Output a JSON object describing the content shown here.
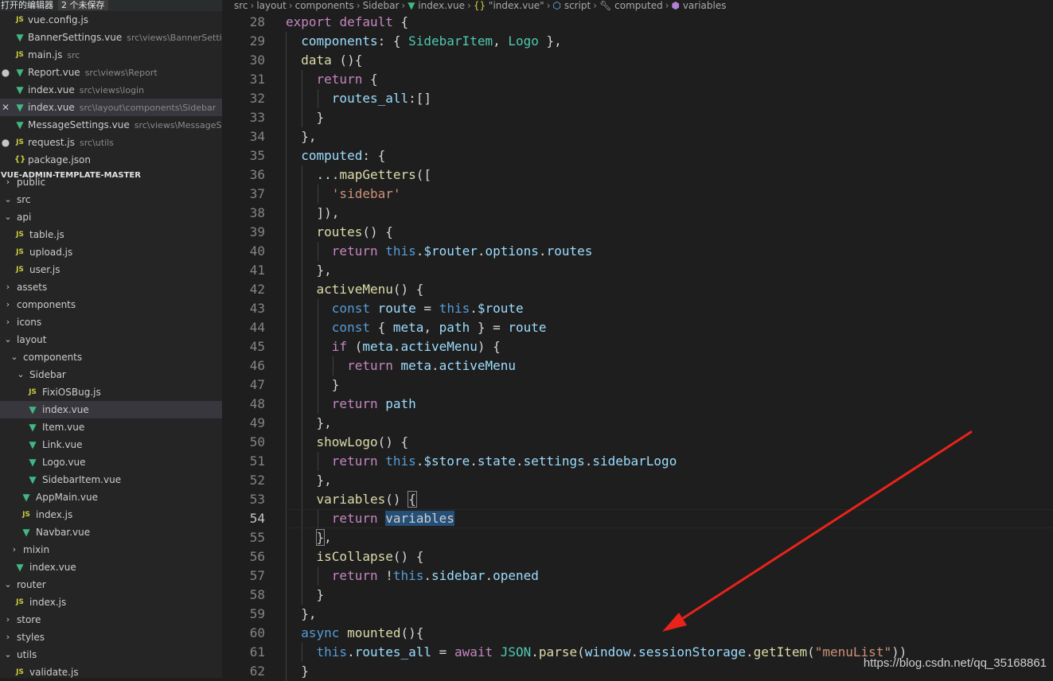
{
  "open_editors": {
    "title": "打开的编辑器",
    "unsaved": "2 个未保存",
    "files": [
      {
        "icon": "JS",
        "name": "vue.config.js",
        "path": "",
        "marker": ""
      },
      {
        "icon": "V",
        "name": "BannerSettings.vue",
        "path": "src\\views\\BannerSettin...",
        "marker": ""
      },
      {
        "icon": "JS",
        "name": "main.js",
        "path": "src",
        "marker": ""
      },
      {
        "icon": "V",
        "name": "Report.vue",
        "path": "src\\views\\Report",
        "marker": "●"
      },
      {
        "icon": "V",
        "name": "index.vue",
        "path": "src\\views\\login",
        "marker": ""
      },
      {
        "icon": "V",
        "name": "index.vue",
        "path": "src\\layout\\components\\Sidebar",
        "marker": "✕"
      },
      {
        "icon": "V",
        "name": "MessageSettings.vue",
        "path": "src\\views\\MessageS...",
        "marker": ""
      },
      {
        "icon": "JS",
        "name": "request.js",
        "path": "src\\utils",
        "marker": "●"
      },
      {
        "icon": "{}",
        "name": "package.json",
        "path": "",
        "marker": ""
      }
    ]
  },
  "explorer": {
    "title": "VUE-ADMIN-TEMPLATE-MASTER",
    "tree": [
      {
        "label": "public",
        "type": "folder",
        "chev": "›"
      },
      {
        "label": "src",
        "type": "folder",
        "chev": "⌄"
      },
      {
        "label": "api",
        "type": "folder",
        "chev": "⌄"
      },
      {
        "label": "table.js",
        "type": "js",
        "chev": ""
      },
      {
        "label": "upload.js",
        "type": "js",
        "chev": ""
      },
      {
        "label": "user.js",
        "type": "js",
        "chev": ""
      },
      {
        "label": "assets",
        "type": "folder",
        "chev": "›"
      },
      {
        "label": "components",
        "type": "folder",
        "chev": "›"
      },
      {
        "label": "icons",
        "type": "folder",
        "chev": "›"
      },
      {
        "label": "layout",
        "type": "folder",
        "chev": "⌄"
      },
      {
        "label": "components",
        "type": "folder",
        "chev": "⌄"
      },
      {
        "label": "Sidebar",
        "type": "folder",
        "chev": "⌄"
      },
      {
        "label": "FixiOSBug.js",
        "type": "js",
        "chev": ""
      },
      {
        "label": "index.vue",
        "type": "vue",
        "chev": ""
      },
      {
        "label": "Item.vue",
        "type": "vue",
        "chev": ""
      },
      {
        "label": "Link.vue",
        "type": "vue",
        "chev": ""
      },
      {
        "label": "Logo.vue",
        "type": "vue",
        "chev": ""
      },
      {
        "label": "SidebarItem.vue",
        "type": "vue",
        "chev": ""
      },
      {
        "label": "AppMain.vue",
        "type": "vue",
        "chev": ""
      },
      {
        "label": "index.js",
        "type": "js",
        "chev": ""
      },
      {
        "label": "Navbar.vue",
        "type": "vue",
        "chev": ""
      },
      {
        "label": "mixin",
        "type": "folder",
        "chev": "›"
      },
      {
        "label": "index.vue",
        "type": "vue",
        "chev": ""
      },
      {
        "label": "router",
        "type": "folder",
        "chev": "⌄"
      },
      {
        "label": "index.js",
        "type": "js",
        "chev": ""
      },
      {
        "label": "store",
        "type": "folder",
        "chev": "›"
      },
      {
        "label": "styles",
        "type": "folder",
        "chev": "›"
      },
      {
        "label": "utils",
        "type": "folder",
        "chev": "⌄"
      },
      {
        "label": "validate.js",
        "type": "js",
        "chev": ""
      }
    ]
  },
  "breadcrumb": [
    "src",
    "layout",
    "components",
    "Sidebar",
    "index.vue",
    "\"index.vue\"",
    "script",
    "computed",
    "variables"
  ],
  "code_lines": [
    {
      "n": "28",
      "tokens": [
        [
          "kc",
          "export"
        ],
        [
          "pl",
          " "
        ],
        [
          "kc",
          "default"
        ],
        [
          "pl",
          " {"
        ]
      ]
    },
    {
      "n": "29",
      "tokens": [
        [
          "pl",
          "  "
        ],
        [
          "pr",
          "components"
        ],
        [
          "pl",
          ": { "
        ],
        [
          "cls",
          "SidebarItem"
        ],
        [
          "pl",
          ", "
        ],
        [
          "cls",
          "Logo"
        ],
        [
          "pl",
          " },"
        ]
      ]
    },
    {
      "n": "30",
      "tokens": [
        [
          "pl",
          "  "
        ],
        [
          "fn",
          "data"
        ],
        [
          "pl",
          " (){"
        ]
      ]
    },
    {
      "n": "31",
      "tokens": [
        [
          "pl",
          "    "
        ],
        [
          "kc",
          "return"
        ],
        [
          "pl",
          " {"
        ]
      ]
    },
    {
      "n": "32",
      "tokens": [
        [
          "pl",
          "      "
        ],
        [
          "pr",
          "routes_all"
        ],
        [
          "pl",
          ":[]"
        ]
      ]
    },
    {
      "n": "33",
      "tokens": [
        [
          "pl",
          "    }"
        ]
      ]
    },
    {
      "n": "34",
      "tokens": [
        [
          "pl",
          "  },"
        ]
      ]
    },
    {
      "n": "35",
      "tokens": [
        [
          "pl",
          "  "
        ],
        [
          "pr",
          "computed"
        ],
        [
          "pl",
          ": {"
        ]
      ]
    },
    {
      "n": "36",
      "tokens": [
        [
          "pl",
          "    ..."
        ],
        [
          "fn",
          "mapGetters"
        ],
        [
          "pl",
          "(["
        ]
      ]
    },
    {
      "n": "37",
      "tokens": [
        [
          "pl",
          "      "
        ],
        [
          "st",
          "'sidebar'"
        ]
      ]
    },
    {
      "n": "38",
      "tokens": [
        [
          "pl",
          "    ]),"
        ]
      ]
    },
    {
      "n": "39",
      "tokens": [
        [
          "pl",
          "    "
        ],
        [
          "fn",
          "routes"
        ],
        [
          "pl",
          "() {"
        ]
      ]
    },
    {
      "n": "40",
      "tokens": [
        [
          "pl",
          "      "
        ],
        [
          "kc",
          "return"
        ],
        [
          "pl",
          " "
        ],
        [
          "kw",
          "this"
        ],
        [
          "pl",
          "."
        ],
        [
          "pr",
          "$router"
        ],
        [
          "pl",
          "."
        ],
        [
          "pr",
          "options"
        ],
        [
          "pl",
          "."
        ],
        [
          "pr",
          "routes"
        ]
      ]
    },
    {
      "n": "41",
      "tokens": [
        [
          "pl",
          "    },"
        ]
      ]
    },
    {
      "n": "42",
      "tokens": [
        [
          "pl",
          "    "
        ],
        [
          "fn",
          "activeMenu"
        ],
        [
          "pl",
          "() {"
        ]
      ]
    },
    {
      "n": "43",
      "tokens": [
        [
          "pl",
          "      "
        ],
        [
          "kw",
          "const"
        ],
        [
          "pl",
          " "
        ],
        [
          "pr",
          "route"
        ],
        [
          "pl",
          " = "
        ],
        [
          "kw",
          "this"
        ],
        [
          "pl",
          "."
        ],
        [
          "pr",
          "$route"
        ]
      ]
    },
    {
      "n": "44",
      "tokens": [
        [
          "pl",
          "      "
        ],
        [
          "kw",
          "const"
        ],
        [
          "pl",
          " { "
        ],
        [
          "pr",
          "meta"
        ],
        [
          "pl",
          ", "
        ],
        [
          "pr",
          "path"
        ],
        [
          "pl",
          " } = "
        ],
        [
          "pr",
          "route"
        ]
      ]
    },
    {
      "n": "45",
      "tokens": [
        [
          "pl",
          "      "
        ],
        [
          "kc",
          "if"
        ],
        [
          "pl",
          " ("
        ],
        [
          "pr",
          "meta"
        ],
        [
          "pl",
          "."
        ],
        [
          "pr",
          "activeMenu"
        ],
        [
          "pl",
          ") {"
        ]
      ]
    },
    {
      "n": "46",
      "tokens": [
        [
          "pl",
          "        "
        ],
        [
          "kc",
          "return"
        ],
        [
          "pl",
          " "
        ],
        [
          "pr",
          "meta"
        ],
        [
          "pl",
          "."
        ],
        [
          "pr",
          "activeMenu"
        ]
      ]
    },
    {
      "n": "47",
      "tokens": [
        [
          "pl",
          "      }"
        ]
      ]
    },
    {
      "n": "48",
      "tokens": [
        [
          "pl",
          "      "
        ],
        [
          "kc",
          "return"
        ],
        [
          "pl",
          " "
        ],
        [
          "pr",
          "path"
        ]
      ]
    },
    {
      "n": "49",
      "tokens": [
        [
          "pl",
          "    },"
        ]
      ]
    },
    {
      "n": "50",
      "tokens": [
        [
          "pl",
          "    "
        ],
        [
          "fn",
          "showLogo"
        ],
        [
          "pl",
          "() {"
        ]
      ]
    },
    {
      "n": "51",
      "tokens": [
        [
          "pl",
          "      "
        ],
        [
          "kc",
          "return"
        ],
        [
          "pl",
          " "
        ],
        [
          "kw",
          "this"
        ],
        [
          "pl",
          "."
        ],
        [
          "pr",
          "$store"
        ],
        [
          "pl",
          "."
        ],
        [
          "pr",
          "state"
        ],
        [
          "pl",
          "."
        ],
        [
          "pr",
          "settings"
        ],
        [
          "pl",
          "."
        ],
        [
          "pr",
          "sidebarLogo"
        ]
      ]
    },
    {
      "n": "52",
      "tokens": [
        [
          "pl",
          "    },"
        ]
      ]
    },
    {
      "n": "53",
      "tokens": [
        [
          "pl",
          "    "
        ],
        [
          "fn",
          "variables"
        ],
        [
          "pl",
          "() "
        ],
        [
          "bm",
          "{"
        ]
      ]
    },
    {
      "n": "54",
      "tokens": [
        [
          "pl",
          "      "
        ],
        [
          "kc",
          "return"
        ],
        [
          "pl",
          " "
        ],
        [
          "hl",
          "variables"
        ]
      ],
      "current": true
    },
    {
      "n": "55",
      "tokens": [
        [
          "pl",
          "    "
        ],
        [
          "bm",
          "}"
        ],
        [
          "pl",
          ","
        ]
      ]
    },
    {
      "n": "56",
      "tokens": [
        [
          "pl",
          "    "
        ],
        [
          "fn",
          "isCollapse"
        ],
        [
          "pl",
          "() {"
        ]
      ]
    },
    {
      "n": "57",
      "tokens": [
        [
          "pl",
          "      "
        ],
        [
          "kc",
          "return"
        ],
        [
          "pl",
          " !"
        ],
        [
          "kw",
          "this"
        ],
        [
          "pl",
          "."
        ],
        [
          "pr",
          "sidebar"
        ],
        [
          "pl",
          "."
        ],
        [
          "pr",
          "opened"
        ]
      ]
    },
    {
      "n": "58",
      "tokens": [
        [
          "pl",
          "    }"
        ]
      ]
    },
    {
      "n": "59",
      "tokens": [
        [
          "pl",
          "  },"
        ]
      ]
    },
    {
      "n": "60",
      "tokens": [
        [
          "pl",
          "  "
        ],
        [
          "kw",
          "async"
        ],
        [
          "pl",
          " "
        ],
        [
          "fn",
          "mounted"
        ],
        [
          "pl",
          "(){"
        ]
      ]
    },
    {
      "n": "61",
      "tokens": [
        [
          "pl",
          "    "
        ],
        [
          "kw",
          "this"
        ],
        [
          "pl",
          "."
        ],
        [
          "pr",
          "routes_all"
        ],
        [
          "pl",
          " = "
        ],
        [
          "kc",
          "await"
        ],
        [
          "pl",
          " "
        ],
        [
          "cls",
          "JSON"
        ],
        [
          "pl",
          "."
        ],
        [
          "fn",
          "parse"
        ],
        [
          "pl",
          "("
        ],
        [
          "pr",
          "window"
        ],
        [
          "pl",
          "."
        ],
        [
          "pr",
          "sessionStorage"
        ],
        [
          "pl",
          "."
        ],
        [
          "fn",
          "getItem"
        ],
        [
          "pl",
          "("
        ],
        [
          "st",
          "\"menuList\""
        ],
        [
          "pl",
          "))"
        ]
      ]
    },
    {
      "n": "62",
      "tokens": [
        [
          "pl",
          "  }"
        ]
      ]
    }
  ],
  "watermark": "https://blog.csdn.net/qq_35168861",
  "colors": {
    "arrow": "#e8231a",
    "accent_vue": "#41b883",
    "accent_js": "#cbcb41"
  }
}
